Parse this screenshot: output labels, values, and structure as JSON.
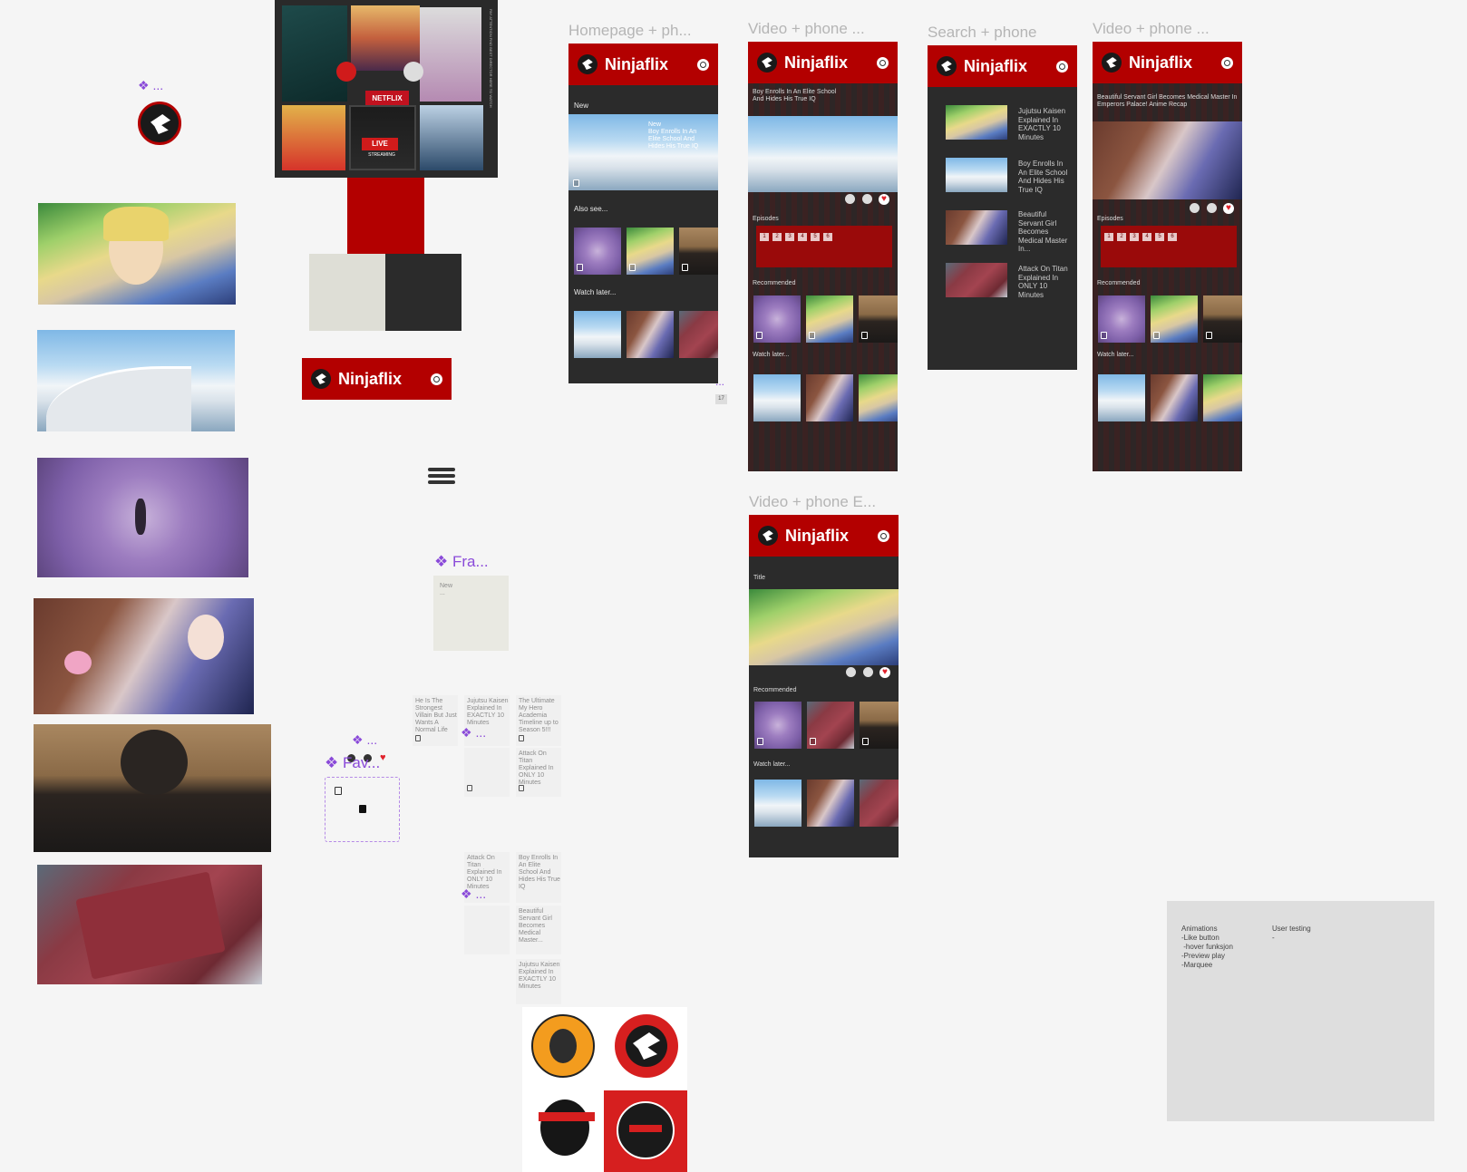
{
  "brand": {
    "name": "Ninjaflix",
    "accent": "#b30000",
    "dark": "#2b2b2b",
    "light": "#deded6"
  },
  "frames": {
    "homepage": "Homepage + ph...",
    "video1": "Video + phone ...",
    "search": "Search + phone",
    "video2": "Video + phone ...",
    "video3": "Video + phone E..."
  },
  "homepage": {
    "new_label": "New",
    "feature_overlay": "New\nBoy Enrolls In An Elite School And Hides His True IQ",
    "also_see": "Also see...",
    "watch_later": "Watch later..."
  },
  "video1": {
    "title": "Boy Enrolls In An Elite School And Hides His True IQ",
    "episodes_label": "Episodes",
    "episodes": [
      "1",
      "2",
      "3",
      "4",
      "5",
      "6"
    ],
    "recommended": "Recommended",
    "watch_later": "Watch later..."
  },
  "search": {
    "results": [
      "Jujutsu Kaisen Explained In EXACTLY 10 Minutes",
      "Boy Enrolls In An Elite School And Hides His True IQ",
      "Beautiful Servant Girl Becomes Medical Master In...",
      "Attack On Titan Explained In ONLY 10 Minutes"
    ]
  },
  "video2": {
    "title": "Beautiful Servant Girl Becomes Medical Master In Emperors Palace! Anime Recap",
    "episodes_label": "Episodes",
    "episodes": [
      "1",
      "2",
      "3",
      "4",
      "5",
      "6"
    ],
    "recommended": "Recommended",
    "watch_later": "Watch later..."
  },
  "video3": {
    "title": "Title",
    "recommended": "Recommended",
    "watch_later": "Watch later..."
  },
  "components": {
    "fra_label": "Fra...",
    "fra_card_text": "New",
    "fra_card_sub": "...",
    "fav_label": "Fav...",
    "dots": "...",
    "card_texts": [
      "He Is The Strongest Villain But Just Wants A Normal Life",
      "Jujutsu Kaisen Explained In EXACTLY 10 Minutes",
      "The Ultimate My Hero Academia Timeline up to Season 5!!!",
      "Attack On Titan Explained In ONLY 10 Minutes",
      "Attack On Titan Explained In ONLY 10 Minutes",
      "Boy Enrolls In An Elite School And Hides His True IQ",
      "Beautiful Servant Girl Becomes Medical Master...",
      "Jujutsu Kaisen Explained In EXACTLY 10 Minutes"
    ]
  },
  "posters": {
    "netflix": "NETFLIX",
    "live": "LIVE",
    "streaming": "STREAMING",
    "vertical_text": "PAY ATTENTION FIND BEST DIRECTOR HERE TO WATCH"
  },
  "notes": {
    "col1_title": "Animations",
    "col1_items": [
      "-Like button",
      " -hover funksjon",
      "-Preview play",
      "-Marquee"
    ],
    "col2_title": "User testing",
    "col2_items": [
      "-"
    ]
  },
  "misc": {
    "info_badge": "17",
    "dots": "..."
  }
}
